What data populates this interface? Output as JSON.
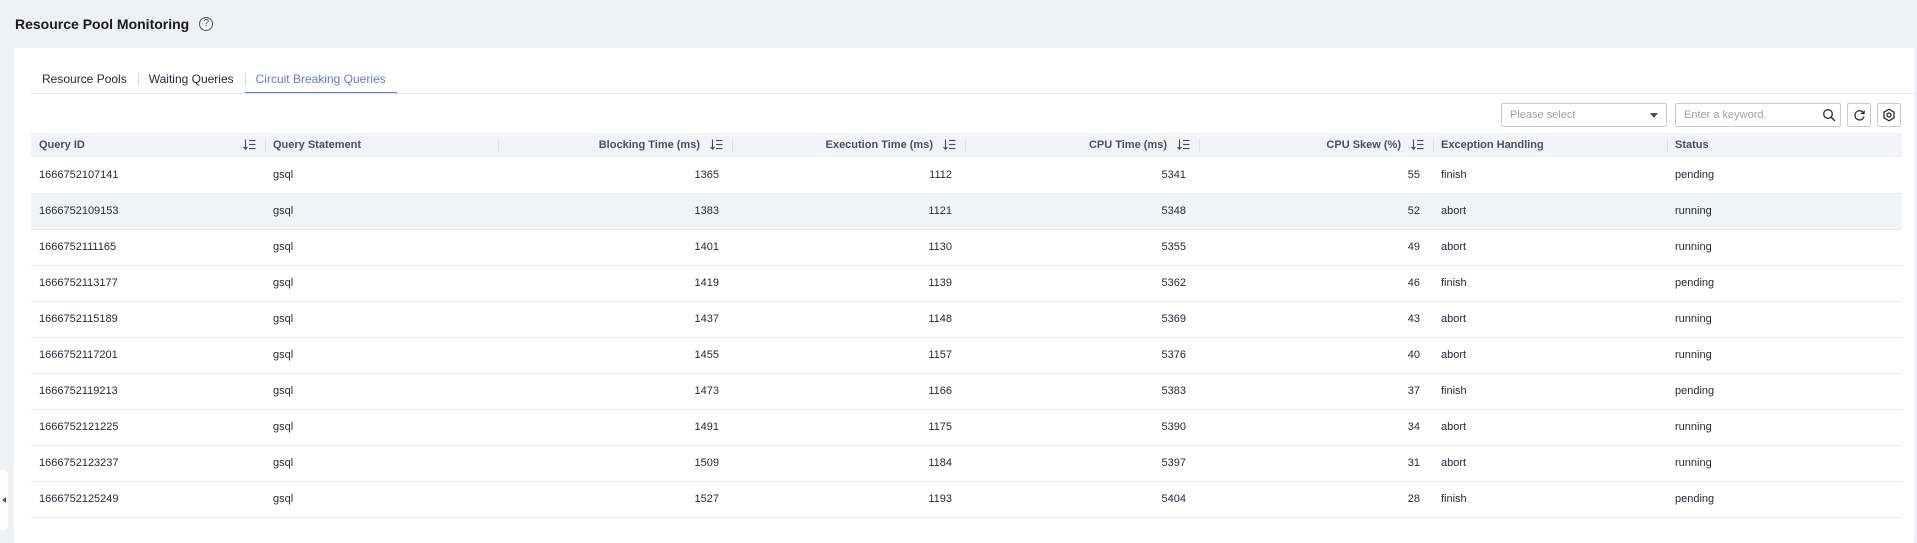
{
  "page": {
    "title": "Resource Pool Monitoring",
    "help_icon": "?"
  },
  "tabs": [
    {
      "label": "Resource Pools",
      "active": false
    },
    {
      "label": "Waiting Queries",
      "active": false
    },
    {
      "label": "Circuit Breaking Queries",
      "active": true
    }
  ],
  "toolbar": {
    "select_placeholder": "Please select",
    "search_placeholder": "Enter a keyword.",
    "refresh_icon": "refresh-icon",
    "settings_icon": "gear-icon"
  },
  "colors": {
    "accent": "#5e7ce0",
    "header_bg": "#f2f3f7",
    "page_bg": "#eef0f5"
  },
  "table": {
    "columns": [
      {
        "label": "Query ID",
        "sortable": true,
        "numeric": false
      },
      {
        "label": "Query Statement",
        "sortable": false,
        "numeric": false
      },
      {
        "label": "Blocking Time (ms)",
        "sortable": true,
        "numeric": true
      },
      {
        "label": "Execution Time (ms)",
        "sortable": true,
        "numeric": true
      },
      {
        "label": "CPU Time (ms)",
        "sortable": true,
        "numeric": true
      },
      {
        "label": "CPU Skew (%)",
        "sortable": true,
        "numeric": true
      },
      {
        "label": "Exception Handling",
        "sortable": false,
        "numeric": false
      },
      {
        "label": "Status",
        "sortable": false,
        "numeric": false
      }
    ],
    "rows": [
      [
        "1666752107141",
        "gsql",
        "1365",
        "1112",
        "5341",
        "55",
        "finish",
        "pending"
      ],
      [
        "1666752109153",
        "gsql",
        "1383",
        "1121",
        "5348",
        "52",
        "abort",
        "running"
      ],
      [
        "1666752111165",
        "gsql",
        "1401",
        "1130",
        "5355",
        "49",
        "abort",
        "running"
      ],
      [
        "1666752113177",
        "gsql",
        "1419",
        "1139",
        "5362",
        "46",
        "finish",
        "pending"
      ],
      [
        "1666752115189",
        "gsql",
        "1437",
        "1148",
        "5369",
        "43",
        "abort",
        "running"
      ],
      [
        "1666752117201",
        "gsql",
        "1455",
        "1157",
        "5376",
        "40",
        "abort",
        "running"
      ],
      [
        "1666752119213",
        "gsql",
        "1473",
        "1166",
        "5383",
        "37",
        "finish",
        "pending"
      ],
      [
        "1666752121225",
        "gsql",
        "1491",
        "1175",
        "5390",
        "34",
        "abort",
        "running"
      ],
      [
        "1666752123237",
        "gsql",
        "1509",
        "1184",
        "5397",
        "31",
        "abort",
        "running"
      ],
      [
        "1666752125249",
        "gsql",
        "1527",
        "1193",
        "5404",
        "28",
        "finish",
        "pending"
      ]
    ],
    "highlighted_row": 1
  }
}
